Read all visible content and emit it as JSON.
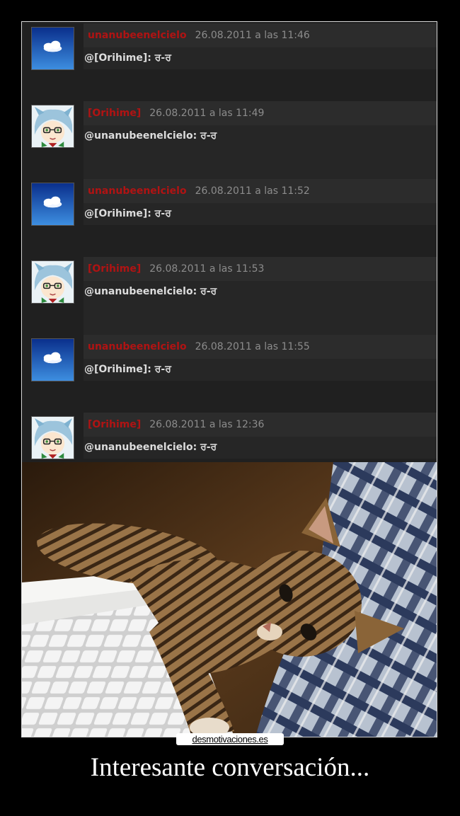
{
  "comments": [
    {
      "author": "unanubeenelcielo",
      "date": "26.08.2011 a las 11:46",
      "text": "@[Orihime]: ਰ-ਰ",
      "avatar": "cloud-avatar"
    },
    {
      "author": "[Orihime]",
      "date": "26.08.2011 a las 11:49",
      "text": "@unanubeenelcielo: ਰ-ਰ",
      "avatar": "anime-girl-avatar"
    },
    {
      "author": "unanubeenelcielo",
      "date": "26.08.2011 a las 11:52",
      "text": "@[Orihime]: ਰ-ਰ",
      "avatar": "cloud-avatar"
    },
    {
      "author": "[Orihime]",
      "date": "26.08.2011 a las 11:53",
      "text": "@unanubeenelcielo: ਰ-ਰ",
      "avatar": "anime-girl-avatar"
    },
    {
      "author": "unanubeenelcielo",
      "date": "26.08.2011 a las 11:55",
      "text": "@[Orihime]: ਰ-ਰ",
      "avatar": "cloud-avatar"
    },
    {
      "author": "[Orihime]",
      "date": "26.08.2011 a las 12:36",
      "text": "@unanubeenelcielo: ਰ-ਰ",
      "avatar": "anime-girl-avatar"
    }
  ],
  "watermark": "desmotivaciones.es",
  "caption": "Interesante conversación...",
  "colors": {
    "author": "#b01313",
    "date": "#8c8c8c",
    "background": "#000000"
  }
}
